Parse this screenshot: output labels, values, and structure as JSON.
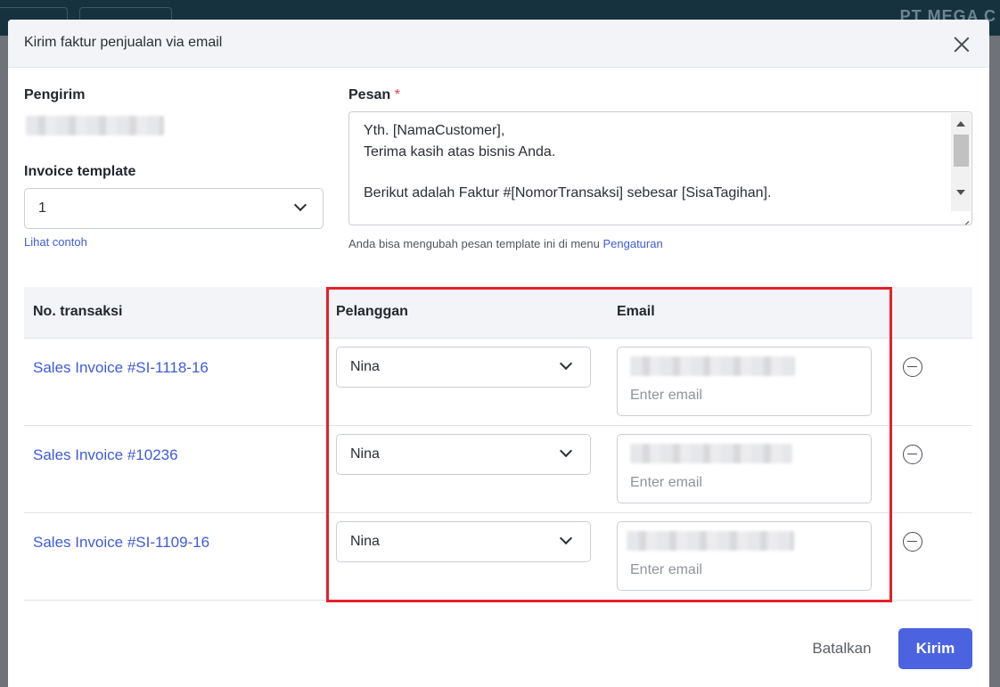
{
  "modal": {
    "title": "Kirim faktur penjualan via email",
    "sender_label": "Pengirim",
    "template_label": "Invoice template",
    "template_value": "1",
    "preview_link": "Lihat contoh",
    "message_label": "Pesan",
    "required_mark": "*",
    "message_lines": [
      "Yth. [NamaCustomer],",
      "Terima kasih atas bisnis Anda.",
      "",
      "Berikut adalah Faktur #[NomorTransaksi] sebesar [SisaTagihan]."
    ],
    "hint_text": "Anda bisa mengubah pesan template ini di menu",
    "hint_link": "Pengaturan",
    "table": {
      "headers": [
        "No. transaksi",
        "Pelanggan",
        "Email"
      ],
      "rows": [
        {
          "transaction": "Sales Invoice #SI-1118-16",
          "customer": "Nina",
          "email_placeholder": "Enter email"
        },
        {
          "transaction": "Sales Invoice #10236",
          "customer": "Nina",
          "email_placeholder": "Enter email"
        },
        {
          "transaction": "Sales Invoice #SI-1109-16",
          "customer": "Nina",
          "email_placeholder": "Enter email"
        }
      ]
    },
    "cancel_label": "Batalkan",
    "send_label": "Kirim"
  },
  "colors": {
    "accent": "#4b63e0",
    "link": "#3f5bd8",
    "highlight": "#e5202b",
    "required": "#e03c3c"
  },
  "background": {
    "brand_fragment": "PT MEGA C"
  }
}
